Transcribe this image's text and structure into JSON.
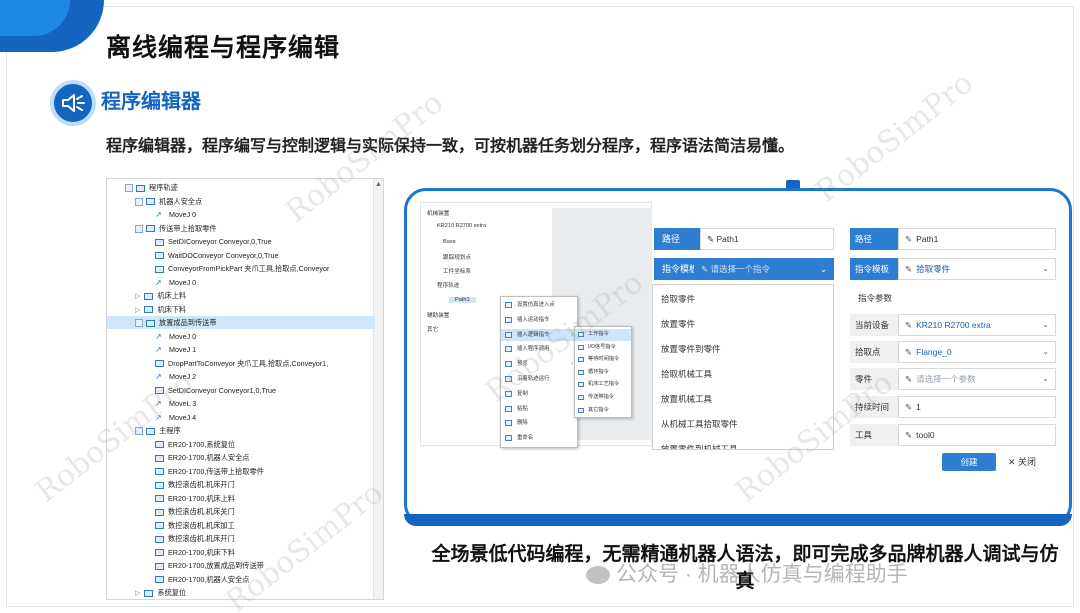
{
  "slide": {
    "title": "离线编程与程序编辑",
    "section_title": "程序编辑器",
    "subtitle": "程序编辑器，程序编写与控制逻辑与实际保持一致，可按机器任务划分程序，程序语法简洁易懂。",
    "bottom_text": "全场景低代码编程，无需精通机器人语法，即可完成多品牌机器人调试与仿真",
    "wechat_watermark": "公众号 · 机器人仿真与编程助手",
    "watermark_text": "RoboSimPro"
  },
  "tree": {
    "rows": [
      {
        "label": "程序轨迹",
        "kind": "folder"
      },
      {
        "label": "机器人安全点",
        "kind": "folder"
      },
      {
        "label": "MoveJ 0",
        "kind": "motion"
      },
      {
        "label": "传送带上拾取零件",
        "kind": "folder"
      },
      {
        "label": "SetDIConveyor Conveyor,0,True",
        "kind": "cmd"
      },
      {
        "label": "WaitDOConveyor Conveyor,0,True",
        "kind": "cmd"
      },
      {
        "label": "ConveyorFromPickPart 夹爪工具,拾取点,Conveyor",
        "kind": "cmd"
      },
      {
        "label": "MoveJ 0",
        "kind": "motion"
      },
      {
        "label": "机床上料",
        "kind": "collapsed"
      },
      {
        "label": "机床下料",
        "kind": "collapsed"
      },
      {
        "label": "放置成品到传送带",
        "kind": "folder"
      },
      {
        "label": "MoveJ 0",
        "kind": "motion"
      },
      {
        "label": "MoveJ 1",
        "kind": "motion"
      },
      {
        "label": "DropPartToConveyor 夹爪工具,拾取点,Conveyor1,",
        "kind": "cmd"
      },
      {
        "label": "MoveJ 2",
        "kind": "motion"
      },
      {
        "label": "SetDIConveyor Conveyor1,0,True",
        "kind": "cmd"
      },
      {
        "label": "MoveL 3",
        "kind": "motion"
      },
      {
        "label": "MoveJ 4",
        "kind": "motion"
      },
      {
        "label": "主程序",
        "kind": "folder"
      },
      {
        "label": "ER20-1700,系统复位",
        "kind": "cmd"
      },
      {
        "label": "ER20-1700,机器人安全点",
        "kind": "cmd"
      },
      {
        "label": "ER20-1700,传送带上拾取零件",
        "kind": "cmd"
      },
      {
        "label": "数控滚齿机,机床开门",
        "kind": "cmd"
      },
      {
        "label": "ER20-1700,机床上料",
        "kind": "cmd"
      },
      {
        "label": "数控滚齿机,机床关门",
        "kind": "cmd"
      },
      {
        "label": "数控滚齿机,机床加工",
        "kind": "cmd"
      },
      {
        "label": "数控滚齿机,机床开门",
        "kind": "cmd"
      },
      {
        "label": "ER20-1700,机床下料",
        "kind": "cmd"
      },
      {
        "label": "ER20-1700,放置成品到传送带",
        "kind": "cmd"
      },
      {
        "label": "ER20-1700,机器人安全点",
        "kind": "cmd"
      },
      {
        "label": "系统复位",
        "kind": "collapsed"
      }
    ]
  },
  "shot1": {
    "rows": [
      "机械装置",
      "KR210 R2700 extra",
      "Base",
      "跟踪规划点",
      "工件坐标系",
      "程序轨迹",
      "Path1",
      "辅助装置",
      "其它"
    ],
    "menu": [
      "设置仿真进入点",
      "插入运动指令",
      "插入逻辑指令",
      "插入程序调用",
      "预览",
      "沿着轨迹运行",
      "复制",
      "粘贴",
      "删除",
      "重命名"
    ],
    "submenu": [
      "工作指令",
      "I/O信号指令",
      "等待时间指令",
      "循环指令",
      "机床工艺指令",
      "传送带指令",
      "其它指令"
    ]
  },
  "form1": {
    "path_label": "路径",
    "path_value": "Path1",
    "template_label": "指令模板",
    "template_placeholder": "请选择一个指令",
    "options": [
      "拾取零件",
      "放置零件",
      "放置零件到零件",
      "拾取机械工具",
      "放置机械工具",
      "从机械工具拾取零件",
      "放置零件到机械工具"
    ]
  },
  "form2": {
    "path_label": "路径",
    "path_value": "Path1",
    "template_label": "指令模板",
    "template_value": "拾取零件",
    "params_header": "指令参数",
    "device_label": "当前设备",
    "device_value": "KR210 R2700 extra",
    "pick_label": "拾取点",
    "pick_value": "Flange_0",
    "part_label": "零件",
    "part_placeholder": "请选择一个参数",
    "hold_label": "持续时间",
    "hold_value": "1",
    "tool_label": "工具",
    "tool_value": "tool0",
    "create_label": "创建",
    "close_label": "关闭"
  },
  "colors": {
    "brand_blue": "#1565c0",
    "form_blue": "#2d7dd2",
    "selection": "#cfe6fb"
  }
}
